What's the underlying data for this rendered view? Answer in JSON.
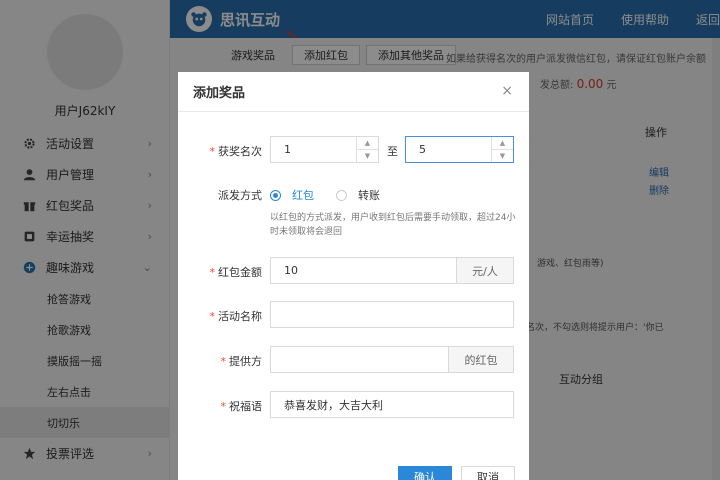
{
  "sidebar": {
    "username": "用户J62kIY",
    "items": [
      {
        "label": "活动设置",
        "icon": "gear-icon"
      },
      {
        "label": "用户管理",
        "icon": "user-icon"
      },
      {
        "label": "红包奖品",
        "icon": "gift-icon"
      },
      {
        "label": "幸运抽奖",
        "icon": "draw-icon"
      },
      {
        "label": "趣味游戏",
        "icon": "game-icon"
      }
    ],
    "sub_items": [
      "抢答游戏",
      "抢歌游戏",
      "摸版摇一摇",
      "左右点击",
      "切切乐"
    ],
    "last_item": {
      "label": "投票评选",
      "icon": "star-icon"
    },
    "chevron": "›",
    "chevron_down": "⌄"
  },
  "header": {
    "logo_text": "思讯互动",
    "nav": [
      "网站首页",
      "使用帮助",
      "返回"
    ],
    "bg_color": "#2970ad"
  },
  "content": {
    "tab_label": "游戏奖品",
    "tab_btn1": "添加红包",
    "tab_btn2": "添加其他奖品",
    "note": "如果给获得名次的用户派发微信红包，请保证红包账户余额",
    "balance_label": "发总额:",
    "balance_value": "0.00",
    "balance_unit": "元",
    "col_op": "操作",
    "link_edit": "编辑",
    "link_del": "删除",
    "bg_text1": "游戏、红包雨等)",
    "bg_text2": "得名次，不勾选则将提示用户：'你已",
    "bg_text3": "互动分组"
  },
  "modal": {
    "title": "添加奖品",
    "close": "×",
    "rank_label": "获奖名次",
    "rank_from": "1",
    "rank_to_label": "至",
    "rank_to": "5",
    "method_label": "派发方式",
    "method_options": [
      "红包",
      "转账"
    ],
    "method_selected": "红包",
    "hint": "以红包的方式派发，用户收到红包后需要手动领取，超过24小时未领取将会退回",
    "amount_label": "红包金额",
    "amount_value": "10",
    "amount_suffix": "元/人",
    "name_label": "活动名称",
    "name_value": "",
    "provider_label": "提供方",
    "provider_value": "",
    "provider_suffix": "的红包",
    "wish_label": "祝福语",
    "wish_value": "恭喜发财，大吉大利",
    "confirm_label": "确认",
    "cancel_label": "取消",
    "required_mark": "*",
    "spin_up": "▲",
    "spin_down": "▼"
  }
}
